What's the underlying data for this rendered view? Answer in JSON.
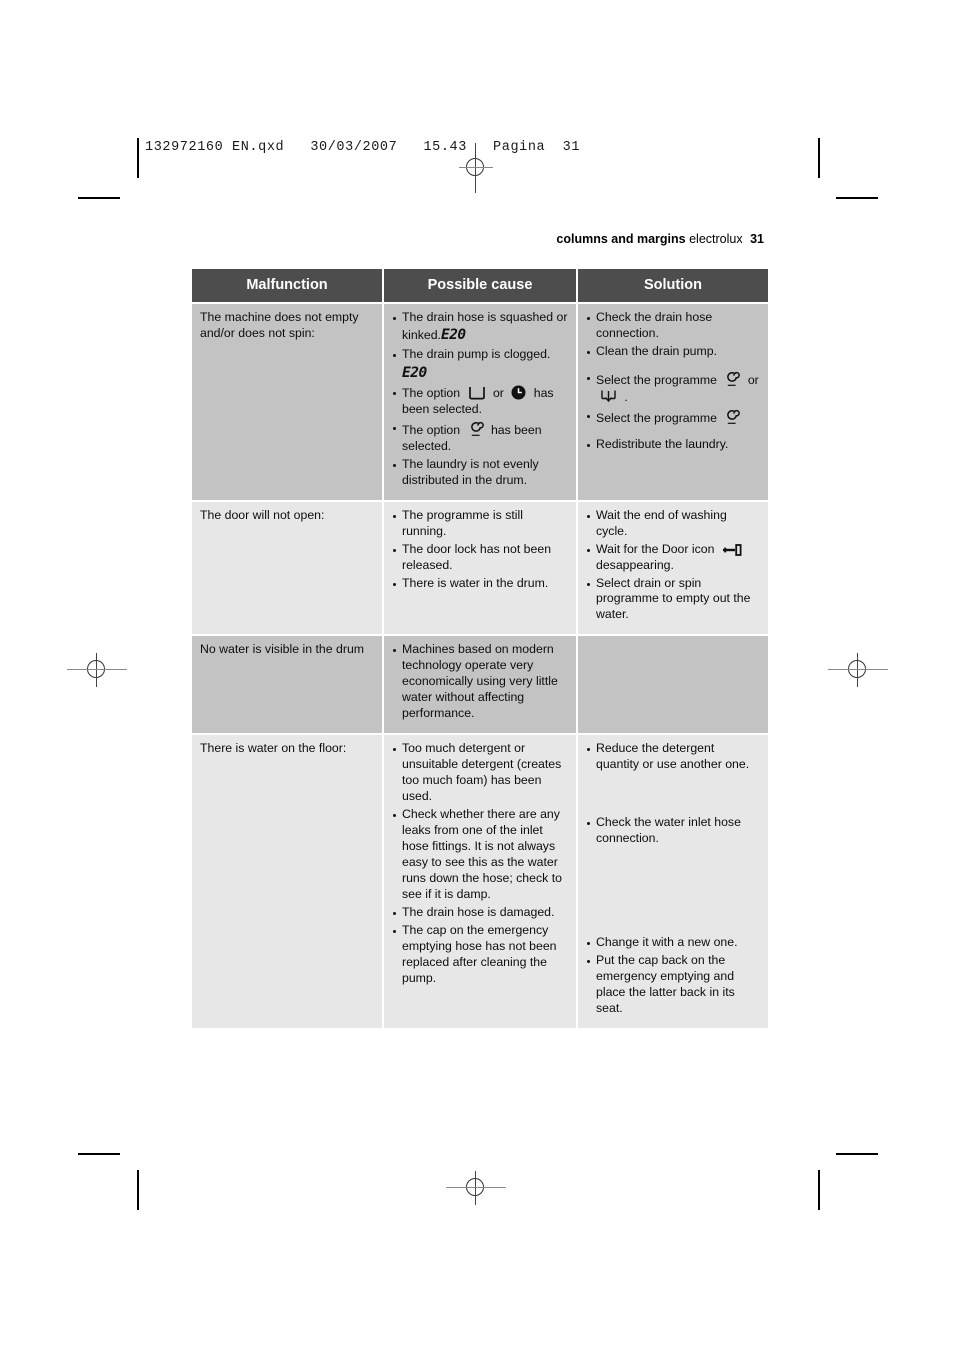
{
  "film_header": "132972160 EN.qxd   30/03/2007   15.43   Pagina  31",
  "running_head": {
    "section": "columns and margins",
    "brand": "electrolux",
    "page": "31"
  },
  "table": {
    "headers": [
      "Malfunction",
      "Possible cause",
      "Solution"
    ],
    "rows": [
      {
        "shade": "dark",
        "malfunction": "The machine does not empty and/or does not spin:",
        "causes": [
          {
            "text": "The drain hose is squashed or kinked.",
            "code": "E20"
          },
          {
            "text": "The drain pump is clogged.",
            "code_block": "E20"
          },
          {
            "pre": "The option",
            "icon1": "rinse-hold-icon",
            "mid": "or",
            "icon2": "delay-start-icon",
            "post": "has been selected."
          },
          {
            "pre": "The option",
            "icon1": "spin-icon",
            "post": "has been selected."
          },
          {
            "text": "The laundry is not evenly distributed in the drum."
          }
        ],
        "solutions": [
          {
            "text": "Check the drain hose connection."
          },
          {
            "text": "Clean the drain pump."
          },
          {
            "pre": "Select the programme",
            "icon1": "spin-icon",
            "mid": "or",
            "icon2": "drain-icon",
            "post": "."
          },
          {
            "pre": "Select the programme",
            "icon1": "spin-icon"
          },
          {
            "text": "Redistribute the laundry."
          }
        ]
      },
      {
        "shade": "light",
        "malfunction": "The door will not open:",
        "causes": [
          {
            "text": "The programme is still running."
          },
          {
            "text": "The door lock has not been released."
          },
          {
            "text": "There is water in the drum."
          }
        ],
        "solutions": [
          {
            "text": "Wait the end of washing cycle."
          },
          {
            "pre": "Wait for the Door icon",
            "icon1": "door-key-icon",
            "post": "desappearing."
          },
          {
            "text": "Select drain or spin programme to empty out the water."
          }
        ]
      },
      {
        "shade": "dark",
        "malfunction": "No water is visible in the drum",
        "causes": [
          {
            "text": "Machines based on modern technology operate very economically using very little water without affecting performance."
          }
        ],
        "solutions": []
      },
      {
        "shade": "light",
        "malfunction": "There is water on the floor:",
        "causes": [
          {
            "text": "Too much detergent or unsuitable detergent (creates too much foam) has been used."
          },
          {
            "text": "Check whether there are any leaks from one of the inlet hose fittings. It is not always easy to see this as the water runs down the hose; check to see if it is damp."
          },
          {
            "text": "The drain hose is damaged."
          },
          {
            "text": "The cap on the emergency emptying hose has not been replaced after cleaning the pump."
          }
        ],
        "solutions": [
          {
            "text": "Reduce the detergent quantity or use another one."
          },
          {
            "text": "Check the water inlet hose connection."
          },
          {
            "text": "Change it with a new one."
          },
          {
            "text": "Put the cap back on the emergency emptying and place the latter back in its seat."
          }
        ]
      }
    ]
  }
}
